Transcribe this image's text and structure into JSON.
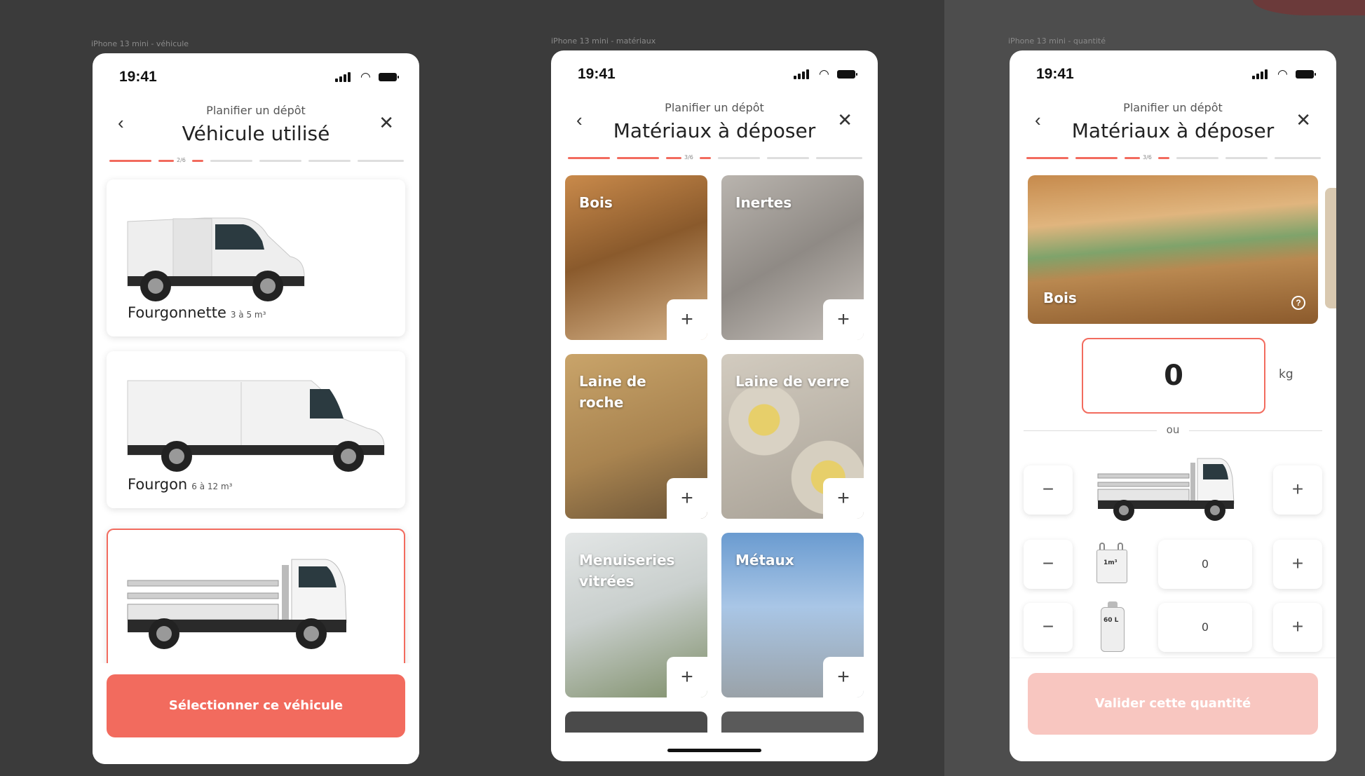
{
  "frames": [
    {
      "label": "iPhone 13 mini - véhicule",
      "time": "19:41",
      "subtitle": "Planifier un dépôt",
      "title": "Véhicule utilisé",
      "step": "2/6",
      "vehicles": [
        {
          "name": "Fourgonnette",
          "capacity": "3 à 5 m³"
        },
        {
          "name": "Fourgon",
          "capacity": "6 à 12 m³"
        },
        {
          "name": "",
          "capacity": ""
        }
      ],
      "cta_label": "Sélectionner ce véhicule"
    },
    {
      "label": "iPhone 13 mini - matériaux",
      "time": "19:41",
      "subtitle": "Planifier un dépôt",
      "title": "Matériaux à déposer",
      "step": "3/6",
      "materials": [
        {
          "label": "Bois"
        },
        {
          "label": "Inertes"
        },
        {
          "label": "Laine de roche"
        },
        {
          "label": "Laine de verre"
        },
        {
          "label": "Menuiseries vitrées"
        },
        {
          "label": "Métaux"
        }
      ],
      "plus": "+"
    },
    {
      "label": "iPhone 13 mini - quantité",
      "time": "19:41",
      "subtitle": "Planifier un dépôt",
      "title": "Matériaux à déposer",
      "step": "3/6",
      "material": "Bois",
      "quantity": "0",
      "unit": "kg",
      "separator": "ou",
      "rows": [
        {
          "minus": "−",
          "plus": "+"
        },
        {
          "minus": "−",
          "plus": "+",
          "value": "0",
          "bag_label": "1m³"
        },
        {
          "minus": "−",
          "plus": "+",
          "value": "0",
          "bag_label": "60 L"
        }
      ],
      "cta_label": "Valider cette quantité"
    }
  ],
  "icons": {
    "back": "chevron-left-icon",
    "close": "close-icon",
    "signal": "signal-icon",
    "wifi": "wifi-icon",
    "battery": "battery-icon",
    "help": "help-icon"
  },
  "colors": {
    "accent": "#f26b5e",
    "accent_disabled": "#f8c6c0",
    "canvas": "#3b3b3b",
    "canvas_right": "#4d4d4d"
  }
}
